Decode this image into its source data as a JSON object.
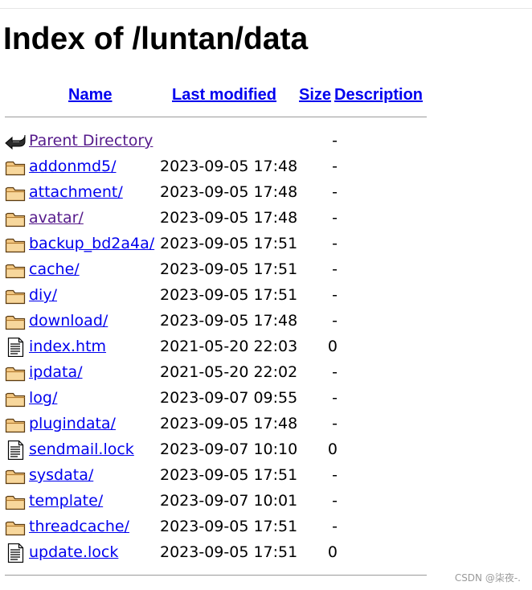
{
  "title": "Index of /luntan/data",
  "columns": {
    "name": "Name",
    "last_modified": "Last modified",
    "size": "Size",
    "description": "Description"
  },
  "entries": [
    {
      "name": "Parent Directory",
      "date": "",
      "size": "-",
      "icon": "back-arrow-icon",
      "visited": true
    },
    {
      "name": "addonmd5/",
      "date": "2023-09-05 17:48",
      "size": "-",
      "icon": "folder-icon",
      "visited": false
    },
    {
      "name": "attachment/",
      "date": "2023-09-05 17:48",
      "size": "-",
      "icon": "folder-icon",
      "visited": false
    },
    {
      "name": "avatar/",
      "date": "2023-09-05 17:48",
      "size": "-",
      "icon": "folder-icon",
      "visited": true
    },
    {
      "name": "backup_bd2a4a/",
      "date": "2023-09-05 17:51",
      "size": "-",
      "icon": "folder-icon",
      "visited": false
    },
    {
      "name": "cache/",
      "date": "2023-09-05 17:51",
      "size": "-",
      "icon": "folder-icon",
      "visited": false
    },
    {
      "name": "diy/",
      "date": "2023-09-05 17:51",
      "size": "-",
      "icon": "folder-icon",
      "visited": false
    },
    {
      "name": "download/",
      "date": "2023-09-05 17:48",
      "size": "-",
      "icon": "folder-icon",
      "visited": false
    },
    {
      "name": "index.htm",
      "date": "2021-05-20 22:03",
      "size": "0",
      "icon": "text-file-icon",
      "visited": false
    },
    {
      "name": "ipdata/",
      "date": "2021-05-20 22:02",
      "size": "-",
      "icon": "folder-icon",
      "visited": false
    },
    {
      "name": "log/",
      "date": "2023-09-07 09:55",
      "size": "-",
      "icon": "folder-icon",
      "visited": false
    },
    {
      "name": "plugindata/",
      "date": "2023-09-05 17:48",
      "size": "-",
      "icon": "folder-icon",
      "visited": false
    },
    {
      "name": "sendmail.lock",
      "date": "2023-09-07 10:10",
      "size": "0",
      "icon": "text-file-icon",
      "visited": false
    },
    {
      "name": "sysdata/",
      "date": "2023-09-05 17:51",
      "size": "-",
      "icon": "folder-icon",
      "visited": false
    },
    {
      "name": "template/",
      "date": "2023-09-07 10:01",
      "size": "-",
      "icon": "folder-icon",
      "visited": false
    },
    {
      "name": "threadcache/",
      "date": "2023-09-05 17:51",
      "size": "-",
      "icon": "folder-icon",
      "visited": false
    },
    {
      "name": "update.lock",
      "date": "2023-09-05 17:51",
      "size": "0",
      "icon": "text-file-icon",
      "visited": false
    }
  ],
  "watermark": "CSDN @柒夜-.",
  "colors": {
    "link": "#0000ee",
    "visited_link": "#551a8b",
    "folder_fill": "#f2c680",
    "rule": "#9a9a9a"
  }
}
